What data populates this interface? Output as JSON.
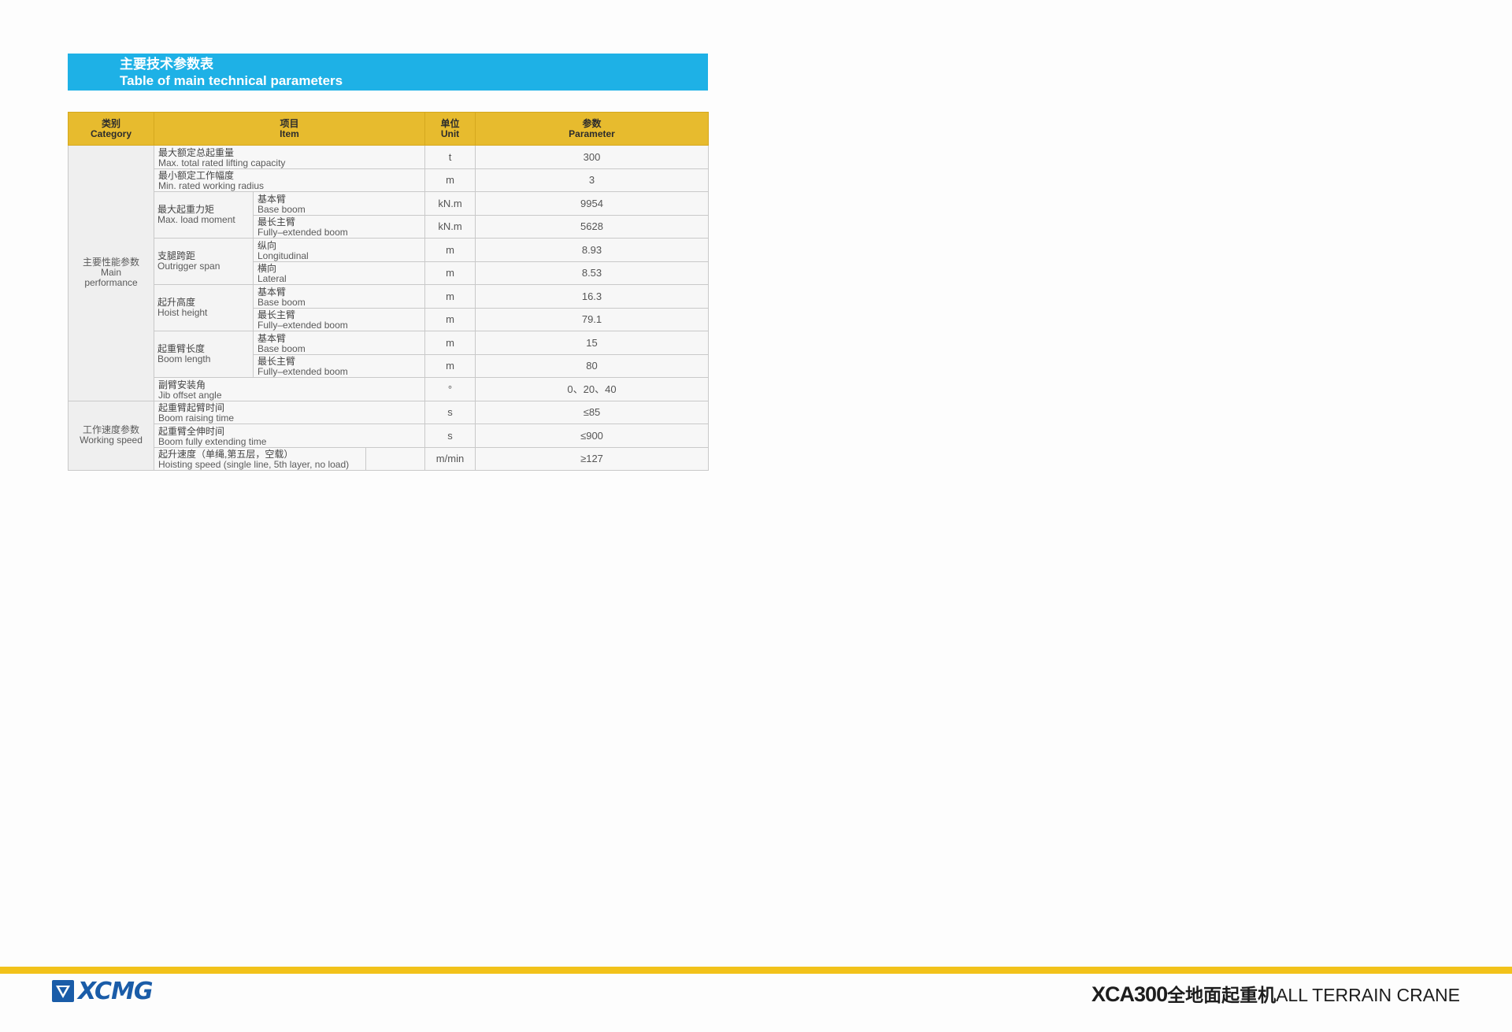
{
  "title": {
    "zh": "主要技术参数表",
    "en": "Table of main technical parameters"
  },
  "table": {
    "headers": {
      "category": {
        "zh": "类别",
        "en": "Category"
      },
      "item": {
        "zh": "项目",
        "en": "Item"
      },
      "unit": {
        "zh": "单位",
        "en": "Unit"
      },
      "parameter": {
        "zh": "参数",
        "en": "Parameter"
      }
    },
    "categories": {
      "main": {
        "zh": "主要性能参数",
        "en1": "Main",
        "en2": "performance"
      },
      "speed": {
        "zh": "工作速度参数",
        "en": "Working speed"
      }
    },
    "groups": {
      "moment": {
        "zh": "最大起重力矩",
        "en": "Max. load moment"
      },
      "outrigger": {
        "zh": "支腿跨距",
        "en": "Outrigger span"
      },
      "hoist": {
        "zh": "起升高度",
        "en": "Hoist height"
      },
      "boom": {
        "zh": "起重臂长度",
        "en": "Boom length"
      }
    },
    "rows": [
      {
        "zh": "最大额定总起重量",
        "en": "Max. total rated lifting capacity",
        "unit": "t",
        "value": "300"
      },
      {
        "zh": "最小额定工作幅度",
        "en": "Min. rated working radius",
        "unit": "m",
        "value": "3"
      },
      {
        "zh": "基本臂",
        "en": "Base boom",
        "unit": "kN.m",
        "value": "9954"
      },
      {
        "zh": "最长主臂",
        "en": "Fully–extended boom",
        "unit": "kN.m",
        "value": "5628"
      },
      {
        "zh": "纵向",
        "en": "Longitudinal",
        "unit": "m",
        "value": "8.93"
      },
      {
        "zh": "横向",
        "en": "Lateral",
        "unit": "m",
        "value": "8.53"
      },
      {
        "zh": "基本臂",
        "en": "Base boom",
        "unit": "m",
        "value": "16.3"
      },
      {
        "zh": "最长主臂",
        "en": "Fully–extended boom",
        "unit": "m",
        "value": "79.1"
      },
      {
        "zh": "基本臂",
        "en": "Base boom",
        "unit": "m",
        "value": "15"
      },
      {
        "zh": "最长主臂",
        "en": "Fully–extended boom",
        "unit": "m",
        "value": "80"
      },
      {
        "zh": "副臂安装角",
        "en": "Jib offset angle",
        "unit": "°",
        "value": "0、20、40"
      },
      {
        "zh": "起重臂起臂时间",
        "en": "Boom raising time",
        "unit": "s",
        "value": "≤85"
      },
      {
        "zh": "起重臂全伸时间",
        "en": "Boom fully extending time",
        "unit": "s",
        "value": "≤900"
      },
      {
        "zh": "起升速度（单绳,第五层，空载）",
        "en": "Hoisting speed (single line, 5th layer, no load)",
        "unit": "m/min",
        "value": "≥127"
      }
    ]
  },
  "footer": {
    "logo": "XCMG",
    "logo_icon": "xcmg-logo-icon",
    "model": "XCA300",
    "product_zh": "全地面起重机",
    "product_en": "ALL TERRAIN CRANE",
    "bar_color": "#f2c21a",
    "brand_color": "#1a5ca8"
  }
}
